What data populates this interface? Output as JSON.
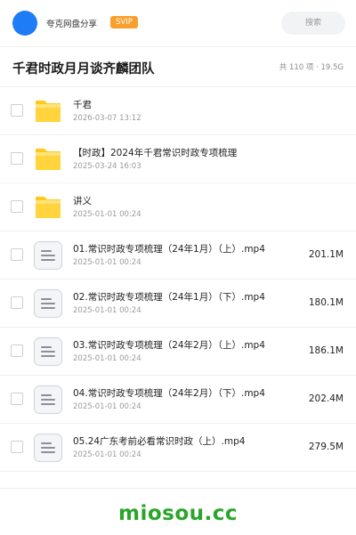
{
  "header": {
    "brand": "夸克网盘分享",
    "badge": "SVIP",
    "search_label": "搜索"
  },
  "share": {
    "title": "千君时政月月谈齐麟团队",
    "summary": "共 110 项 · 19.5G"
  },
  "files": [
    {
      "type": "folder",
      "name": "千君",
      "date": "2026-03-07 13:12",
      "size": ""
    },
    {
      "type": "folder",
      "name": "【时政】2024年千君常识时政专项梳理",
      "date": "2025-03-24 16:03",
      "size": ""
    },
    {
      "type": "folder",
      "name": "讲义",
      "date": "2025-01-01 00:24",
      "size": ""
    },
    {
      "type": "video",
      "name": "01.常识时政专项梳理（24年1月）（上）.mp4",
      "date": "2025-01-01 00:24",
      "size": "201.1M"
    },
    {
      "type": "video",
      "name": "02.常识时政专项梳理（24年1月）（下）.mp4",
      "date": "2025-01-01 00:24",
      "size": "180.1M"
    },
    {
      "type": "video",
      "name": "03.常识时政专项梳理（24年2月）（上）.mp4",
      "date": "2025-01-01 00:24",
      "size": "186.1M"
    },
    {
      "type": "video",
      "name": "04.常识时政专项梳理（24年2月）（下）.mp4",
      "date": "2025-01-01 00:24",
      "size": "202.4M"
    },
    {
      "type": "video",
      "name": "05.24广东考前必看常识时政（上）.mp4",
      "date": "2025-01-01 00:24",
      "size": "279.5M"
    }
  ],
  "footer": {
    "watermark": "miosou.cc"
  },
  "colors": {
    "avatar": "#1e7cf7",
    "badge": "#f7a02d",
    "folder": "#ffc91c",
    "watermark": "#2aa52a"
  }
}
